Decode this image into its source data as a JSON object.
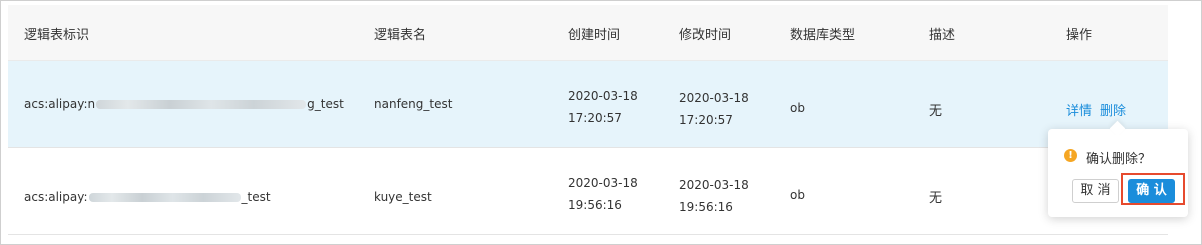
{
  "table": {
    "headers": {
      "id": "逻辑表标识",
      "name": "逻辑表名",
      "created": "创建时间",
      "modified": "修改时间",
      "db_type": "数据库类型",
      "description": "描述",
      "actions": "操作"
    },
    "rows": [
      {
        "id_prefix": "acs:alipay:n",
        "id_suffix": "g_test",
        "name": "nanfeng_test",
        "created_date": "2020-03-18",
        "created_time": "17:20:57",
        "modified_date": "2020-03-18",
        "modified_time": "17:20:57",
        "db_type": "ob",
        "description": "无",
        "action_detail": "详情",
        "action_delete": "删除"
      },
      {
        "id_prefix": "acs:alipay:",
        "id_suffix": "_test",
        "name": "kuye_test",
        "created_date": "2020-03-18",
        "created_time": "19:56:16",
        "modified_date": "2020-03-18",
        "modified_time": "19:56:16",
        "db_type": "ob",
        "description": "无"
      }
    ]
  },
  "popover": {
    "icon": "warning-icon",
    "icon_glyph": "!",
    "message": "确认删除？",
    "cancel_label": "取 消",
    "confirm_label": "确 认"
  },
  "colors": {
    "link": "#1a8ddb",
    "selected_row": "#e6f4fb",
    "header_bg": "#f7f7f7",
    "warning": "#f5a623",
    "primary": "#1a8ddb",
    "highlight": "#e64a2e"
  }
}
